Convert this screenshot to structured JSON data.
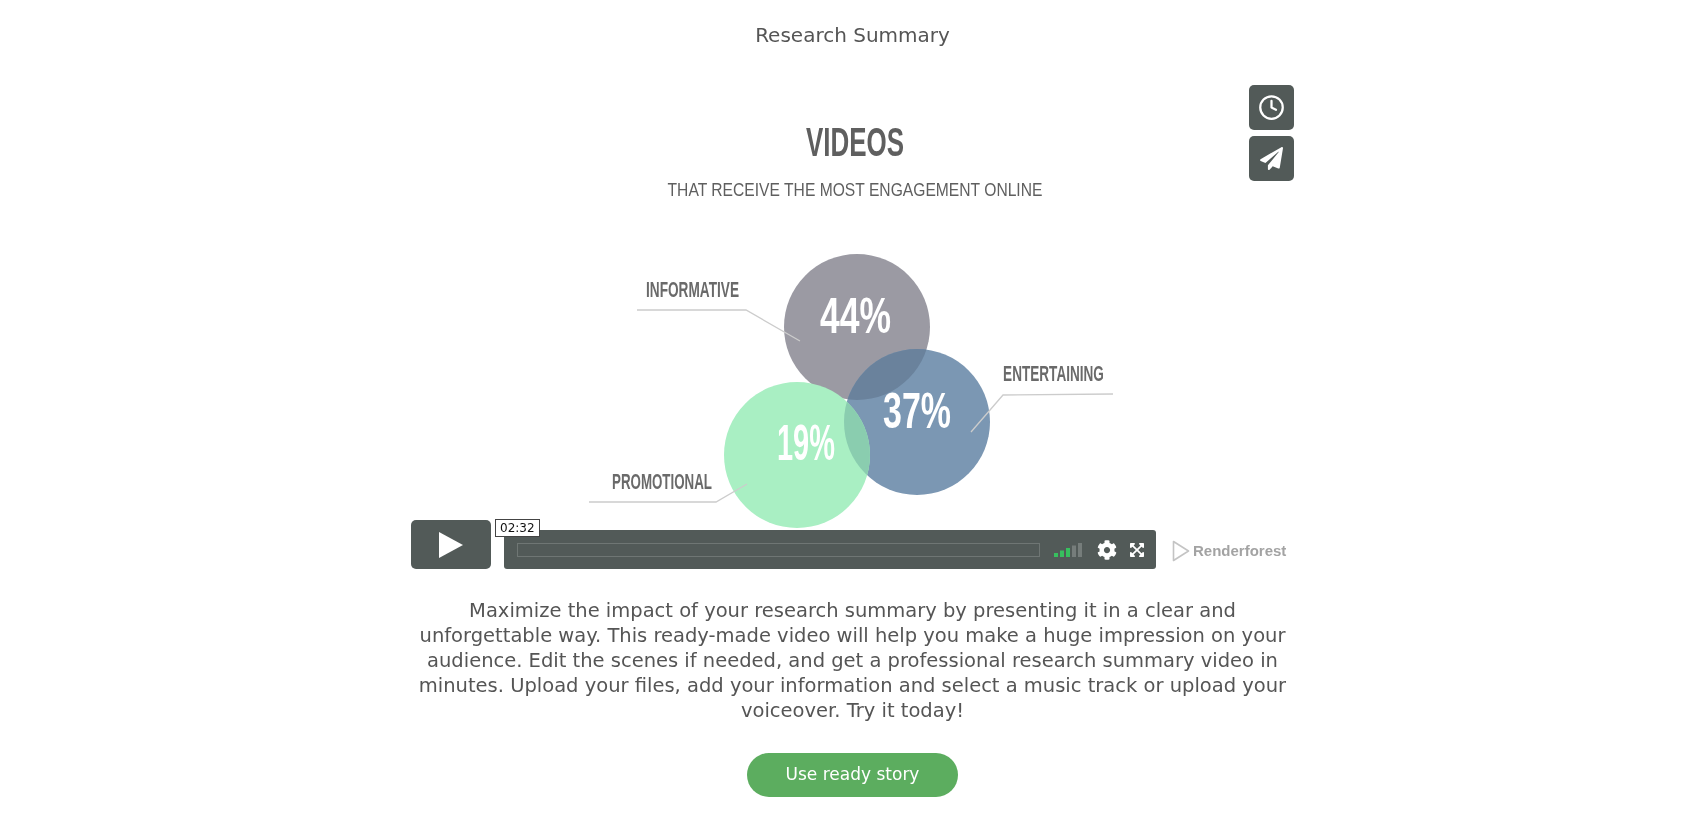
{
  "page": {
    "title": "Research Summary"
  },
  "video": {
    "infographic": {
      "title": "VIDEOS",
      "subtitle": "THAT RECEIVE THE MOST ENGAGEMENT ONLINE",
      "bubbles": [
        {
          "label": "INFORMATIVE",
          "value": "44%",
          "color": "#9b9aa3"
        },
        {
          "label": "ENTERTAINING",
          "value": "37%",
          "color": "#7b97b3"
        },
        {
          "label": "PROMOTIONAL",
          "value": "19%",
          "color": "#a9efc3"
        }
      ]
    },
    "player": {
      "time_tooltip": "02:32",
      "volume": {
        "level": 0.6
      },
      "logo": "Renderforest"
    }
  },
  "description": "Maximize the impact of your research summary by presenting it in a clear and unforgettable way. This ready-made video will help you make a huge impression on your audience. Edit the scenes if needed, and get a professional research summary video in minutes. Upload your files, add your information and select a music track or upload your voiceover. Try it today!",
  "cta_button": "Use ready story"
}
